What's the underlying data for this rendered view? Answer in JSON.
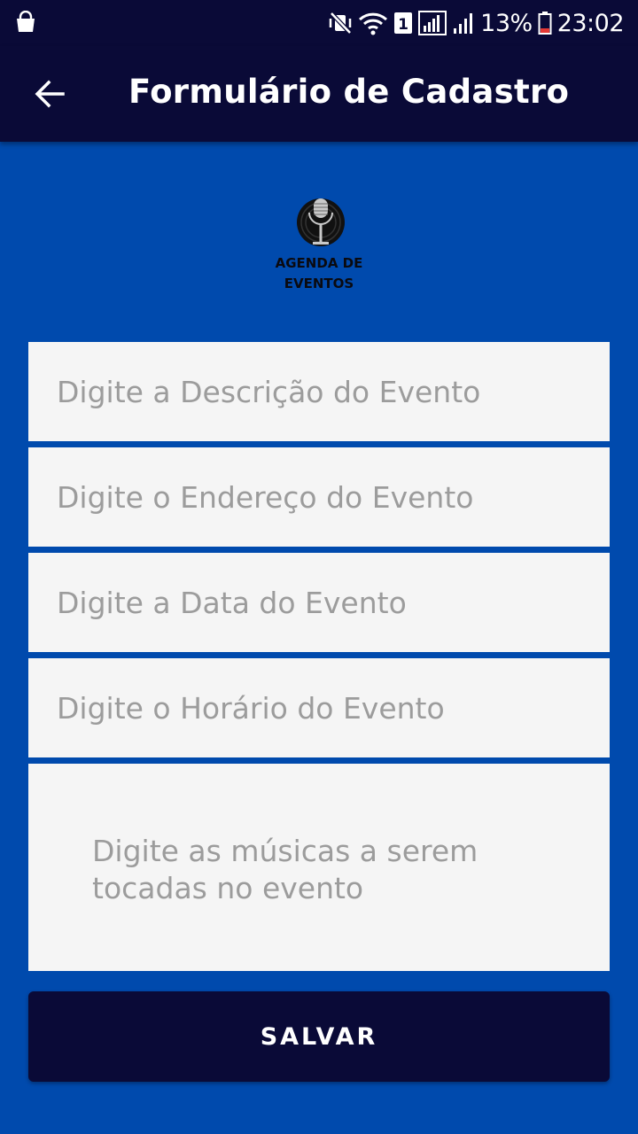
{
  "status_bar": {
    "battery_percent": "13%",
    "time": "23:02",
    "sim_badge": "1",
    "icons": [
      "shopping-bag-icon",
      "mute-vibrate-icon",
      "wifi-icon",
      "sim-1-icon",
      "signal-icon",
      "signal-2-icon",
      "battery-icon"
    ]
  },
  "app_bar": {
    "back_icon": "arrow-left-icon",
    "title": "Formulário de Cadastro",
    "background": "#0a0a37"
  },
  "logo": {
    "icon": "microphone-icon",
    "text_line1": "AGENDA DE",
    "text_line2": "EVENTOS"
  },
  "form": {
    "background": "#004aad",
    "description_placeholder": "Digite a Descrição do Evento",
    "address_placeholder": "Digite o Endereço do Evento",
    "date_placeholder": "Digite a Data do Evento",
    "time_placeholder": "Digite o Horário do Evento",
    "songs_placeholder": "Digite as músicas a serem tocadas no evento",
    "save_label": "SALVAR"
  }
}
